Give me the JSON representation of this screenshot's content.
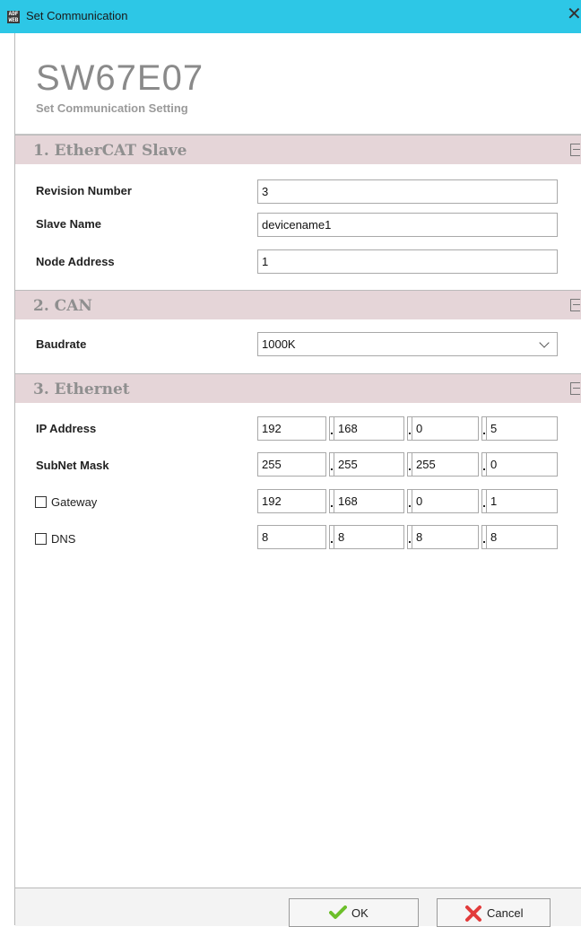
{
  "window": {
    "title": "Set Communication",
    "icon_text": "ADF WEB",
    "close_icon": "close-x-icon"
  },
  "header": {
    "title": "SW67E07",
    "subtitle": "Set Communication Setting"
  },
  "sections": {
    "ethercat": {
      "title": "1. EtherCAT Slave",
      "revision_label": "Revision Number",
      "revision_value": "3",
      "slave_name_label": "Slave Name",
      "slave_name_value": "devicename1",
      "node_address_label": "Node Address",
      "node_address_value": "1"
    },
    "can": {
      "title": "2. CAN",
      "baudrate_label": "Baudrate",
      "baudrate_value": "1000K"
    },
    "ethernet": {
      "title": "3. Ethernet",
      "ip_label": "IP Address",
      "ip": [
        "192",
        "168",
        "0",
        "5"
      ],
      "subnet_label": "SubNet Mask",
      "subnet": [
        "255",
        "255",
        "255",
        "0"
      ],
      "gateway_label": "Gateway",
      "gateway_checked": false,
      "gateway": [
        "192",
        "168",
        "0",
        "1"
      ],
      "dns_label": "DNS",
      "dns_checked": false,
      "dns": [
        "8",
        "8",
        "8",
        "8"
      ]
    }
  },
  "footer": {
    "ok_label": "OK",
    "cancel_label": "Cancel"
  },
  "colors": {
    "titlebar": "#2dc7e6",
    "section_header": "#e5d5d8",
    "ok_check": "#6cbf2a",
    "cancel_x": "#e23b3b"
  }
}
